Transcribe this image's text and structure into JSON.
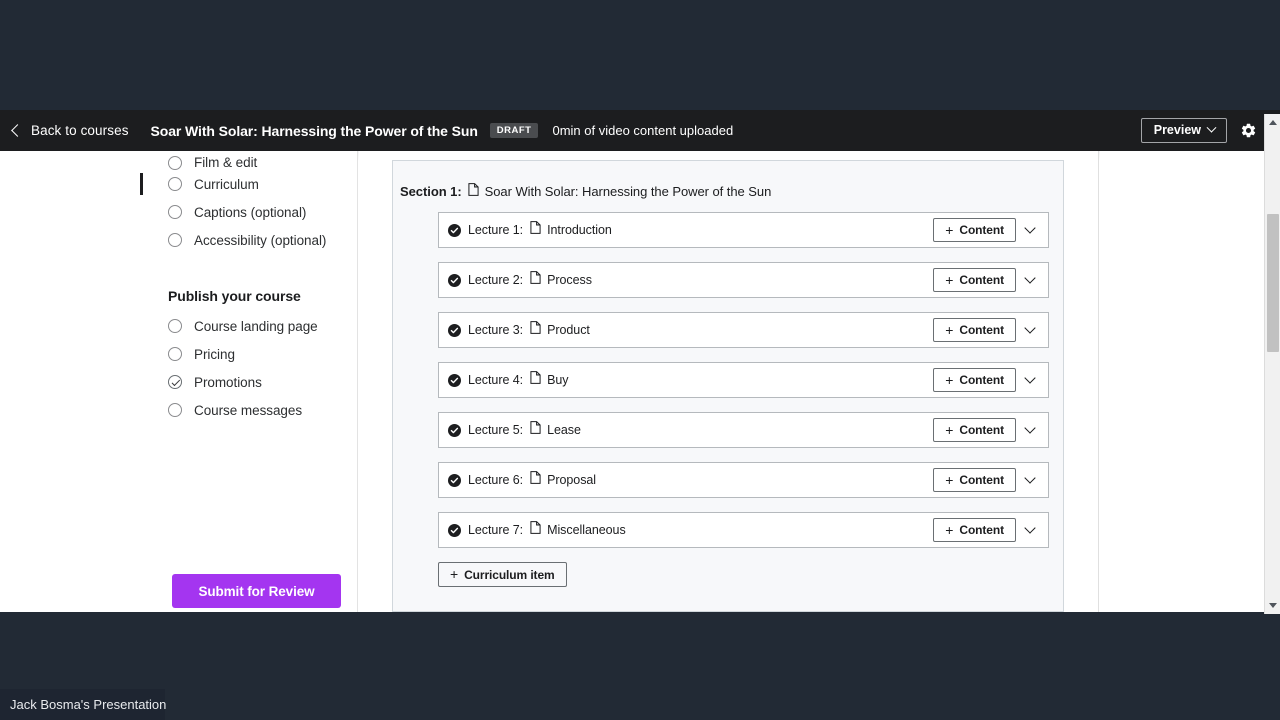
{
  "header": {
    "back_label": "Back to courses",
    "course_title": "Soar With Solar: Harnessing the Power of the Sun",
    "status_badge": "DRAFT",
    "upload_status": "0min of video content uploaded",
    "preview_label": "Preview",
    "back_icon": "chevron-left-icon",
    "settings_icon": "gear-icon",
    "background_color": "#1c1d1f"
  },
  "sidebar": {
    "items": [
      {
        "label": "Film & edit",
        "checked": false,
        "active": false,
        "clipped": true
      },
      {
        "label": "Curriculum",
        "checked": false,
        "active": true,
        "clipped": false
      },
      {
        "label": "Captions (optional)",
        "checked": false,
        "active": false,
        "clipped": false
      },
      {
        "label": "Accessibility (optional)",
        "checked": false,
        "active": false,
        "clipped": false
      }
    ],
    "publish_heading": "Publish your course",
    "publish_items": [
      {
        "label": "Course landing page",
        "checked": false
      },
      {
        "label": "Pricing",
        "checked": false
      },
      {
        "label": "Promotions",
        "checked": true
      },
      {
        "label": "Course messages",
        "checked": false
      }
    ],
    "submit_label": "Submit for Review",
    "submit_color": "#a435f0"
  },
  "curriculum": {
    "section_label": "Section 1:",
    "section_title": "Soar With Solar: Harnessing the Power of the Sun",
    "content_button_label": "Content",
    "add_curriculum_item_label": "Curriculum item",
    "lectures": [
      {
        "num": "Lecture 1:",
        "title": "Introduction"
      },
      {
        "num": "Lecture 2:",
        "title": "Process"
      },
      {
        "num": "Lecture 3:",
        "title": "Product"
      },
      {
        "num": "Lecture 4:",
        "title": "Buy"
      },
      {
        "num": "Lecture 5:",
        "title": "Lease"
      },
      {
        "num": "Lecture 6:",
        "title": "Proposal"
      },
      {
        "num": "Lecture 7:",
        "title": "Miscellaneous"
      }
    ]
  },
  "scrollbar": {
    "up_icon": "triangle-up-icon",
    "down_icon": "triangle-down-icon"
  },
  "overlay": {
    "presentation_label": "Jack Bosma's Presentation"
  }
}
